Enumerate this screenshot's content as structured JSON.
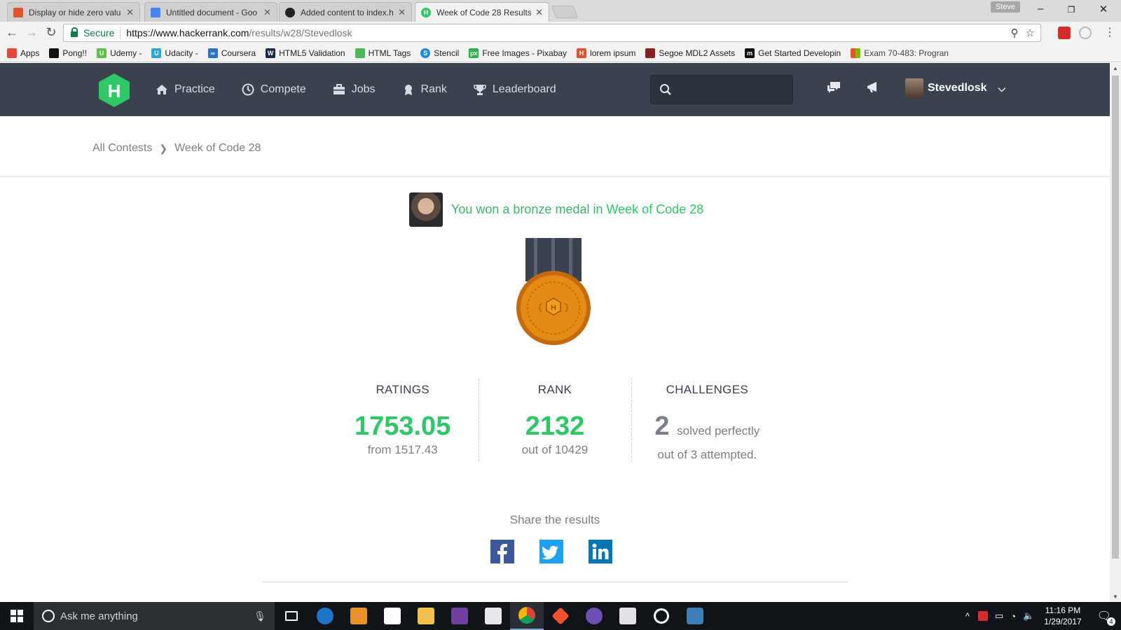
{
  "browser": {
    "tabs": [
      {
        "title": "Display or hide zero valu",
        "color": "#e2532d",
        "glyph": ""
      },
      {
        "title": "Untitled document - Goo",
        "color": "#4285f4",
        "glyph": ""
      },
      {
        "title": "Added content to index.h",
        "color": "#222222",
        "glyph": ""
      },
      {
        "title": "Week of Code 28 Results",
        "color": "#2ec866",
        "glyph": "H"
      }
    ],
    "profile": "Steve",
    "secure_label": "Secure",
    "url_host": "https://www.hackerrank.com",
    "url_path": "/results/w28/Stevedlosk"
  },
  "bookmarks": [
    {
      "label": "Apps",
      "color": "#e04a3c"
    },
    {
      "label": "Pong!!",
      "color": "#111111"
    },
    {
      "label": "Udemy -",
      "color": "#5fbf4b"
    },
    {
      "label": "Udacity -",
      "color": "#2aa6d8"
    },
    {
      "label": "Coursera",
      "color": "#2a73cc"
    },
    {
      "label": "HTML5 Validation",
      "color": "#1d2a4a"
    },
    {
      "label": "HTML Tags",
      "color": "#4bb85c"
    },
    {
      "label": "Stencil",
      "color": "#1f8ae3"
    },
    {
      "label": "Free Images - Pixabay",
      "color": "#2eb24c"
    },
    {
      "label": "lorem ipsum",
      "color": "#e2532d"
    },
    {
      "label": "Segoe MDL2 Assets",
      "color": "#8c1d1d"
    },
    {
      "label": "Get Started Developin",
      "color": "#111111"
    },
    {
      "label": "Exam 70-483: Progran",
      "color": "#f25022"
    }
  ],
  "hr": {
    "menu": [
      {
        "label": "Practice",
        "icon": "home-icon"
      },
      {
        "label": "Compete",
        "icon": "clock-icon"
      },
      {
        "label": "Jobs",
        "icon": "briefcase-icon"
      },
      {
        "label": "Rank",
        "icon": "badge-icon"
      },
      {
        "label": "Leaderboard",
        "icon": "trophy-icon"
      }
    ],
    "username": "Stevedlosk",
    "accent": "#2ec866",
    "nav_bg": "#39424e"
  },
  "breadcrumb": {
    "root": "All Contests",
    "current": "Week of Code 28"
  },
  "result": {
    "message_prefix": "You won a bronze medal in",
    "contest": "Week of Code 28",
    "ratings": {
      "label": "RATINGS",
      "value": "1753.05",
      "sub": "from 1517.43"
    },
    "rank": {
      "label": "RANK",
      "value": "2132",
      "sub": "out of 10429"
    },
    "challenges": {
      "label": "CHALLENGES",
      "value": "2",
      "inline": "solved perfectly",
      "sub": "out of 3 attempted."
    }
  },
  "share": {
    "label": "Share the results"
  },
  "taskbar": {
    "search_placeholder": "Ask me anything",
    "time": "11:16 PM",
    "date": "1/29/2017",
    "notifications": "4"
  }
}
